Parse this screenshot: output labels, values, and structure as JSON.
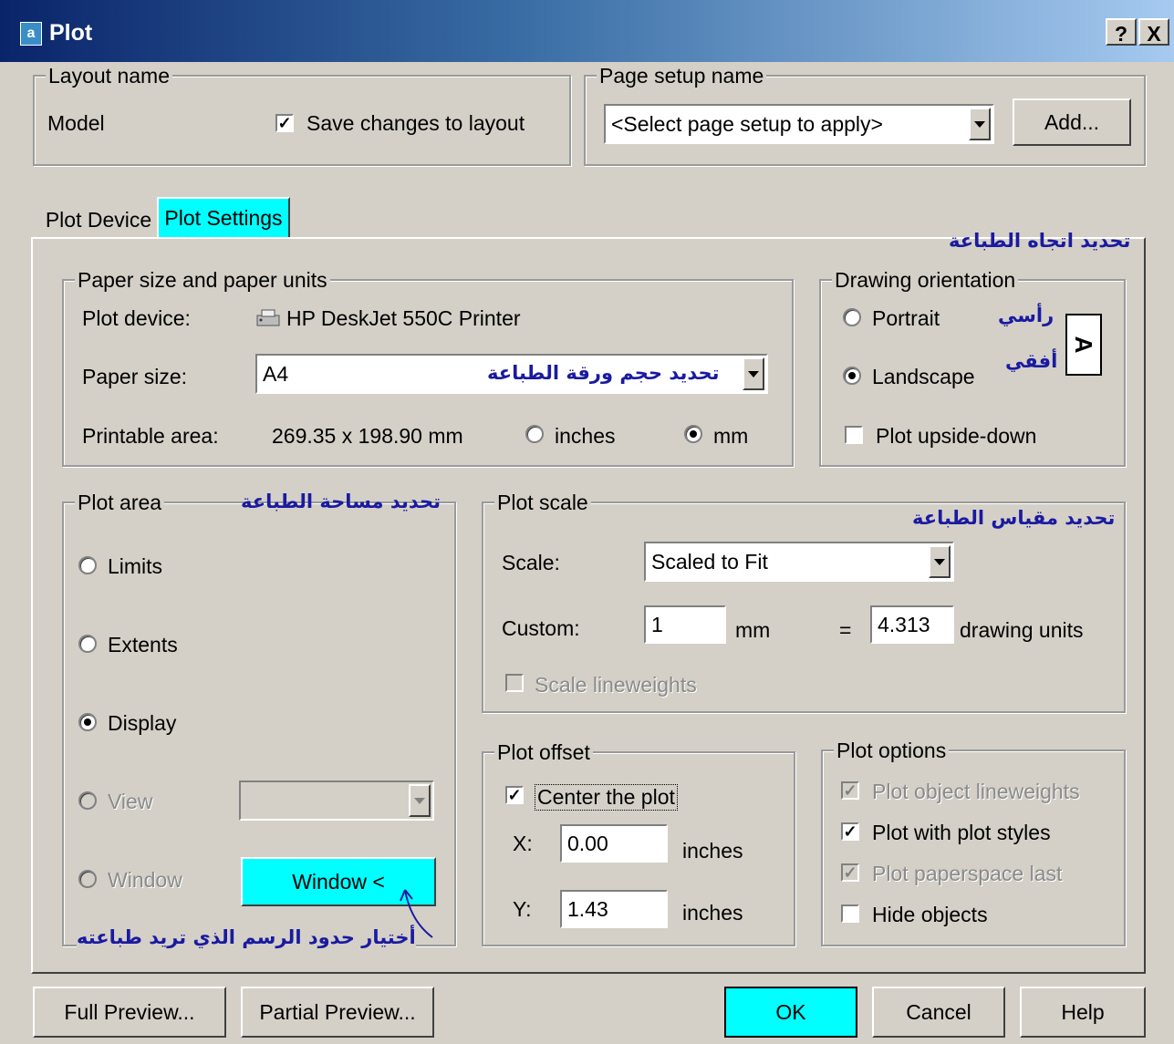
{
  "window": {
    "title": "Plot",
    "icon": "a",
    "help_glyph": "?",
    "close_glyph": "X"
  },
  "layout_name": {
    "legend": "Layout name",
    "value": "Model",
    "save_changes_label": "Save changes to layout",
    "save_changes_checked": true
  },
  "page_setup": {
    "legend": "Page setup name",
    "selected": "<Select page setup to apply>",
    "add_button": "Add..."
  },
  "tabs": [
    {
      "label": "Plot Device",
      "active": false
    },
    {
      "label": "Plot Settings",
      "active": true
    }
  ],
  "annotations": {
    "orientation": "تحديد اتجاه الطباعة",
    "paper_size": "تحديد حجم ورقة الطباعة",
    "plot_area": "تحديد مساحة الطباعة",
    "plot_scale": "تحديد مقياس الطباعة",
    "portrait": "رأسي",
    "landscape": "أفقي",
    "window": "أختيار حدود الرسم الذي تريد طباعته"
  },
  "paper": {
    "legend": "Paper size and paper units",
    "plot_device_label": "Plot device:",
    "plot_device_value": "HP DeskJet 550C Printer",
    "paper_size_label": "Paper size:",
    "paper_size_value": "A4",
    "printable_label": "Printable area:",
    "printable_value": "269.35 x 198.90 mm",
    "unit_inches": "inches",
    "unit_mm": "mm",
    "selected_unit": "mm"
  },
  "orientation": {
    "legend": "Drawing orientation",
    "portrait": "Portrait",
    "landscape": "Landscape",
    "upside_down": "Plot upside-down",
    "selected": "landscape",
    "upside_down_checked": false,
    "icon_glyph": "A"
  },
  "plot_area": {
    "legend": "Plot area",
    "limits": "Limits",
    "extents": "Extents",
    "display": "Display",
    "view": "View",
    "window": "Window",
    "window_button": "Window <",
    "selected": "display"
  },
  "plot_scale": {
    "legend": "Plot scale",
    "scale_label": "Scale:",
    "scale_value": "Scaled to Fit",
    "custom_label": "Custom:",
    "custom_value": "1",
    "custom_unit": "mm",
    "equals": "=",
    "drawing_value": "4.313",
    "drawing_unit": "drawing units",
    "lineweights": "Scale lineweights"
  },
  "plot_offset": {
    "legend": "Plot offset",
    "center": "Center the plot",
    "center_checked": true,
    "x_label": "X:",
    "x_value": "0.00",
    "x_unit": "inches",
    "y_label": "Y:",
    "y_value": "1.43",
    "y_unit": "inches"
  },
  "plot_options": {
    "legend": "Plot options",
    "object_lineweights": "Plot object lineweights",
    "with_plot_styles": "Plot with plot styles",
    "paperspace_last": "Plot paperspace last",
    "hide_objects": "Hide objects"
  },
  "buttons": {
    "full_preview": "Full Preview...",
    "partial_preview": "Partial Preview...",
    "ok": "OK",
    "cancel": "Cancel",
    "help": "Help"
  },
  "colors": {
    "highlight": "#00ffff",
    "annotation": "#1a1aa0",
    "face": "#d4d0c8"
  }
}
